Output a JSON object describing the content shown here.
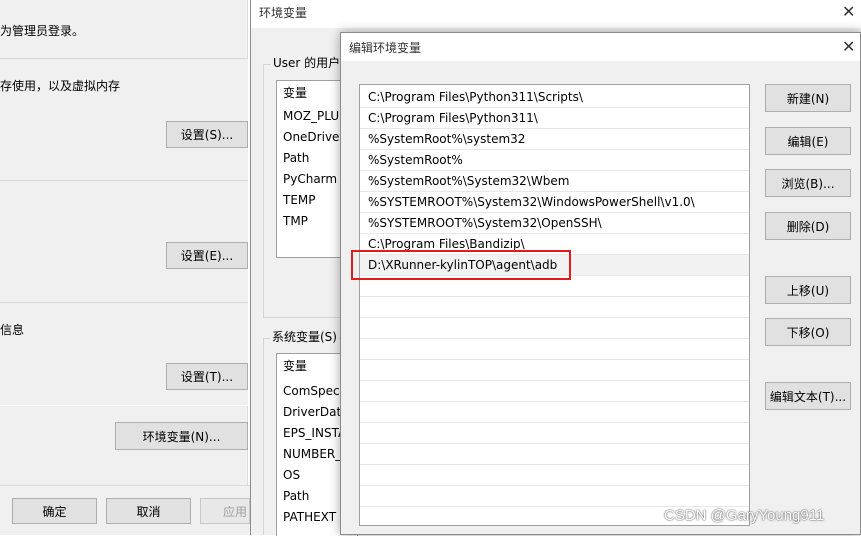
{
  "left_window": {
    "admin_note": "为管理员登录。",
    "perf_text": "存使用，以及虚拟内存",
    "settings_perf": "设置(S)...",
    "settings_profile": "设置(E)...",
    "info_text": "信息",
    "settings_startup": "设置(T)...",
    "env_vars_button": "环境变量(N)...",
    "ok": "确定",
    "cancel": "取消",
    "apply": "应用"
  },
  "env_window": {
    "title": "环境变量",
    "user_group_label": "User 的用户变量",
    "user_list_header": "变量",
    "user_vars": [
      "MOZ_PLU",
      "OneDrive",
      "Path",
      "PyCharm",
      "TEMP",
      "TMP"
    ],
    "system_group_label": "系统变量(S)",
    "system_list_header": "变量",
    "system_vars": [
      "ComSpec",
      "DriverData",
      "EPS_INSTA",
      "NUMBER_",
      "OS",
      "Path",
      "PATHEXT"
    ]
  },
  "edit_dialog": {
    "title": "编辑环境变量",
    "paths": [
      "C:\\Program Files\\Python311\\Scripts\\",
      "C:\\Program Files\\Python311\\",
      "%SystemRoot%\\system32",
      "%SystemRoot%",
      "%SystemRoot%\\System32\\Wbem",
      "%SYSTEMROOT%\\System32\\WindowsPowerShell\\v1.0\\",
      "%SYSTEMROOT%\\System32\\OpenSSH\\",
      "C:\\Program Files\\Bandizip\\",
      "D:\\XRunner-kylinTOP\\agent\\adb"
    ],
    "selected_index": 8,
    "buttons": {
      "new": "新建(N)",
      "edit": "编辑(E)",
      "browse": "浏览(B)...",
      "delete": "删除(D)",
      "move_up": "上移(U)",
      "move_down": "下移(O)",
      "edit_text": "编辑文本(T)..."
    }
  },
  "watermark": "CSDN @GaryYoung911",
  "colors": {
    "highlight_border": "#e31b1b",
    "dialog_bg": "#f0f0f0",
    "button_bg": "#e1e1e1"
  }
}
